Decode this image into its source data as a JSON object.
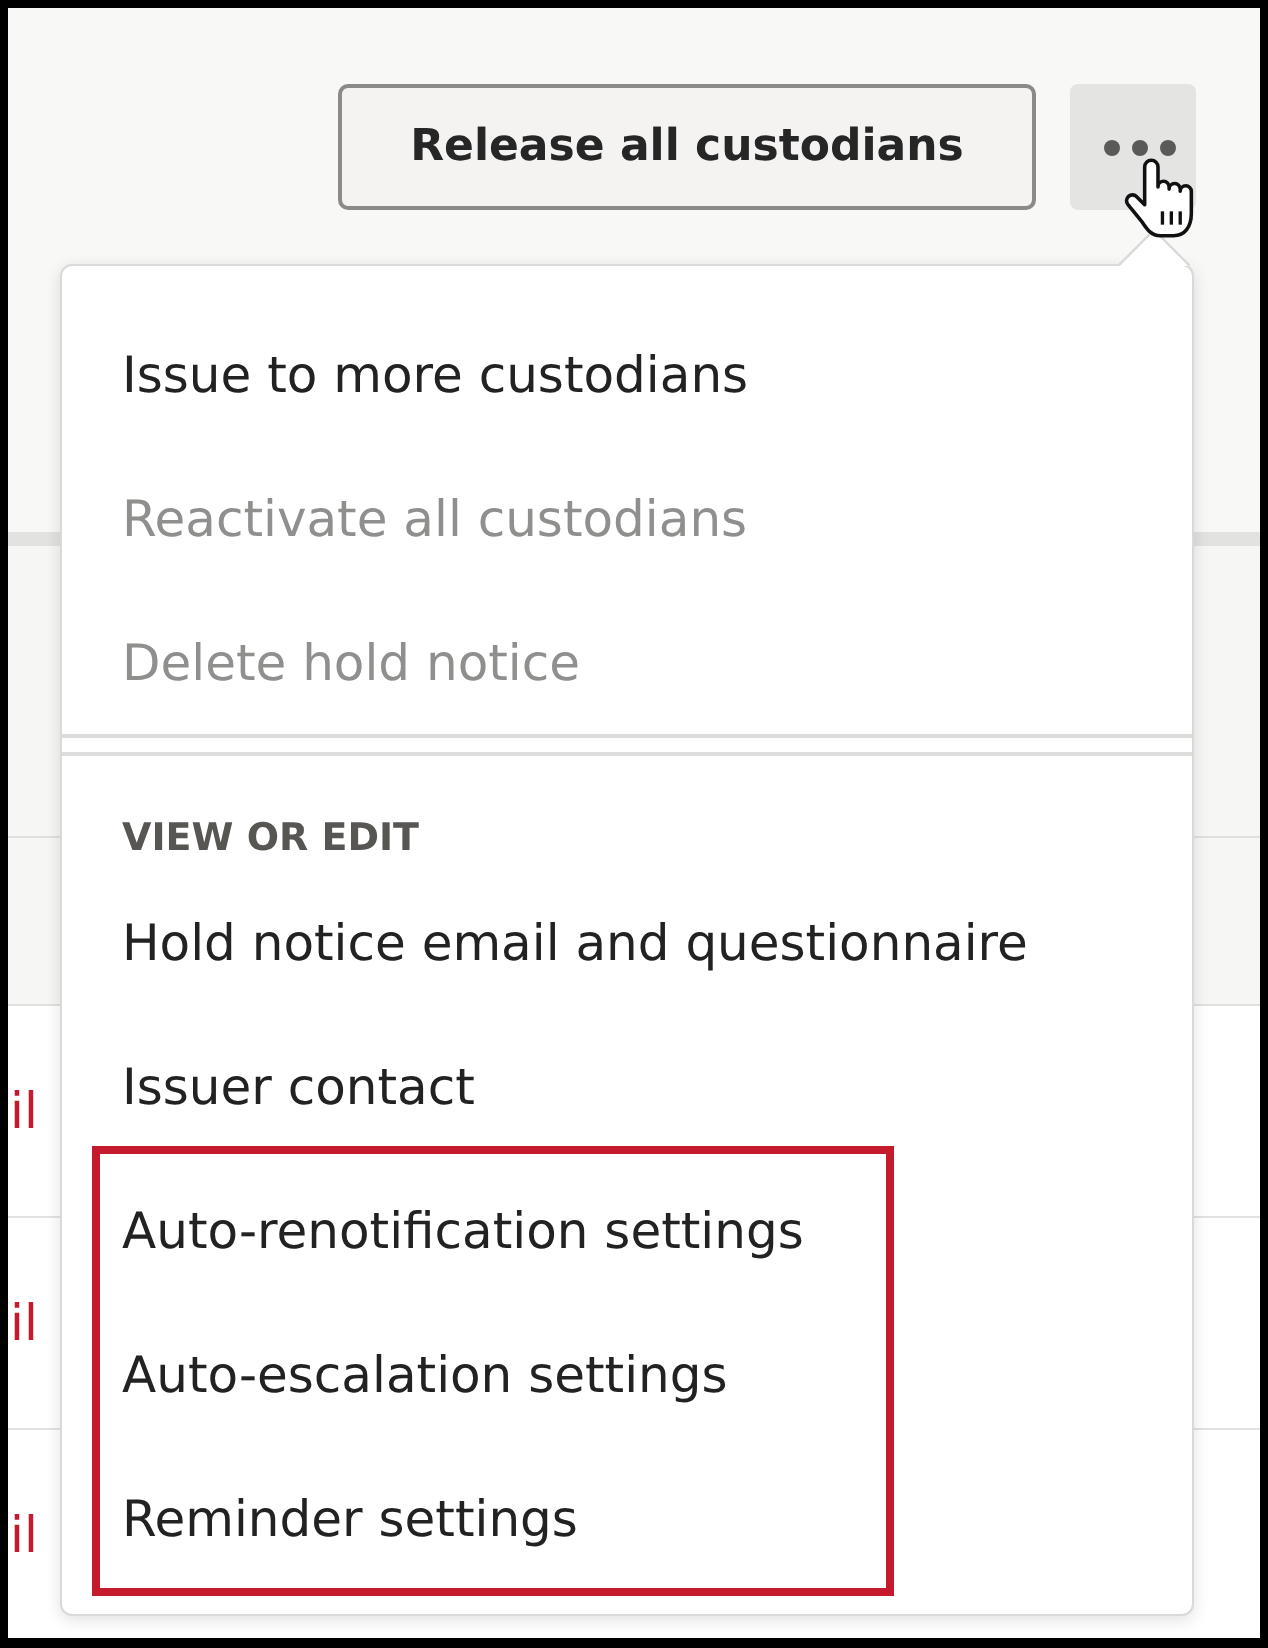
{
  "toolbar": {
    "release_button": {
      "label": "Release all custodians"
    },
    "more_button": {
      "expanded": true
    }
  },
  "table": {
    "rows": [
      {
        "link": "il"
      },
      {
        "link": "il"
      },
      {
        "link": "il"
      }
    ]
  },
  "menu": {
    "sections": [
      {
        "items": [
          {
            "label": "Issue to more custodians",
            "disabled": false,
            "highlighted": false
          },
          {
            "label": "Reactivate all custodians",
            "disabled": true,
            "highlighted": false
          },
          {
            "label": "Delete hold notice",
            "disabled": true,
            "highlighted": false
          }
        ]
      },
      {
        "heading": "VIEW OR EDIT",
        "items": [
          {
            "label": "Hold notice email and questionnaire",
            "disabled": false,
            "highlighted": false
          },
          {
            "label": "Issuer contact",
            "disabled": false,
            "highlighted": false
          },
          {
            "label": "Auto-renotification settings",
            "disabled": false,
            "highlighted": true
          },
          {
            "label": "Auto-escalation settings",
            "disabled": false,
            "highlighted": true
          },
          {
            "label": "Reminder settings",
            "disabled": false,
            "highlighted": true
          }
        ]
      }
    ]
  }
}
